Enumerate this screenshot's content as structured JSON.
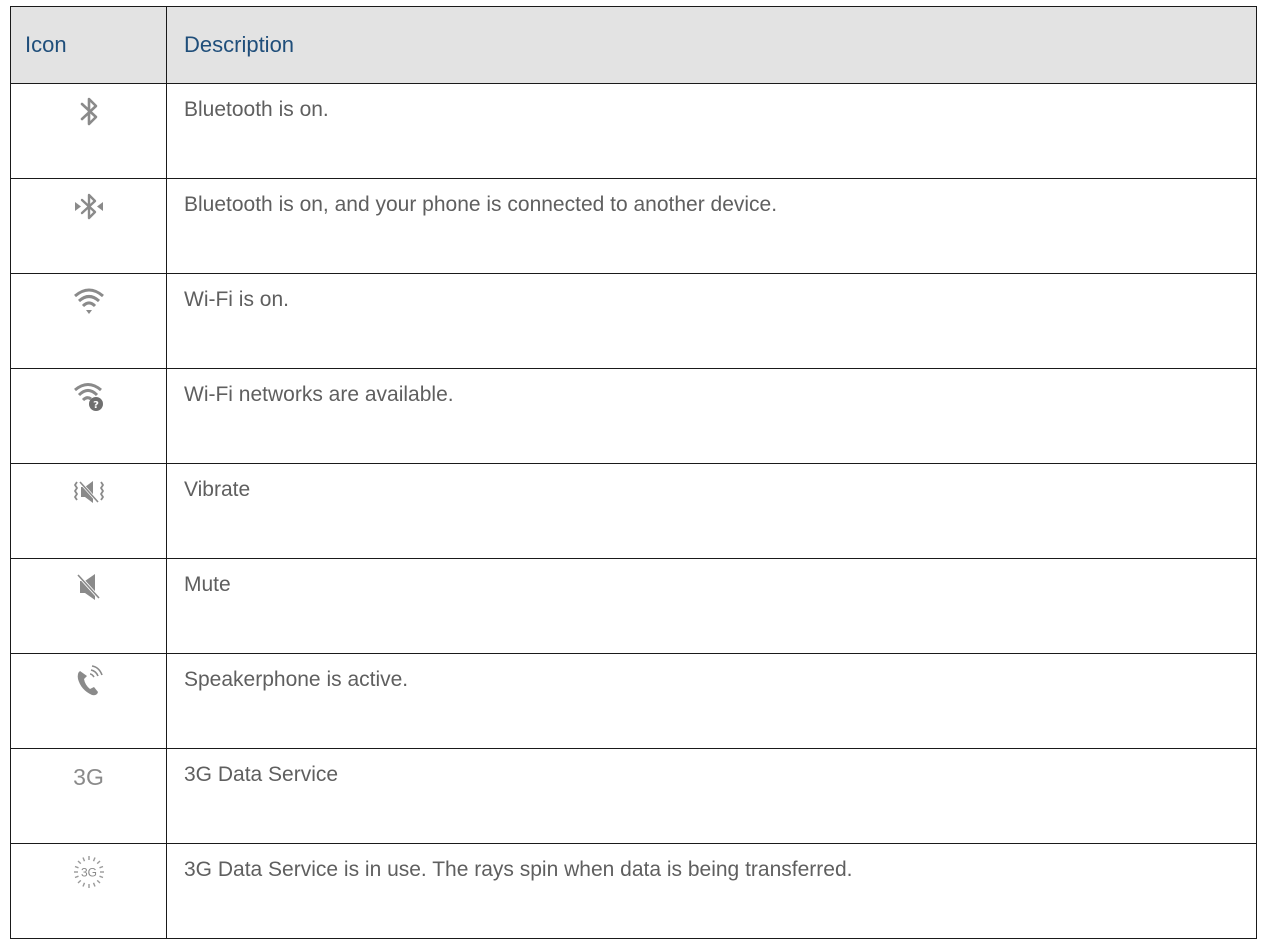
{
  "table": {
    "header": {
      "icon": "Icon",
      "description": "Description"
    },
    "rows": [
      {
        "icon_name": "bluetooth-icon",
        "icon_text": "",
        "description": "Bluetooth is on."
      },
      {
        "icon_name": "bluetooth-connected-icon",
        "icon_text": "",
        "description": "Bluetooth is on, and your phone is connected to another device."
      },
      {
        "icon_name": "wifi-icon",
        "icon_text": "",
        "description": "Wi-Fi is on."
      },
      {
        "icon_name": "wifi-available-icon",
        "icon_text": "",
        "description": "Wi-Fi networks are available."
      },
      {
        "icon_name": "vibrate-icon",
        "icon_text": "",
        "description": "Vibrate"
      },
      {
        "icon_name": "mute-icon",
        "icon_text": "",
        "description": "Mute"
      },
      {
        "icon_name": "speakerphone-icon",
        "icon_text": "",
        "description": "Speakerphone is active."
      },
      {
        "icon_name": "3g-icon",
        "icon_text": "3G",
        "description": "3G Data Service"
      },
      {
        "icon_name": "3g-in-use-icon",
        "icon_text": "3G",
        "description": "3G Data Service is in use. The rays spin when data is being transferred."
      }
    ]
  },
  "colors": {
    "header_background": "#e3e3e3",
    "header_text": "#1f4e7a",
    "body_text": "#5f5f5f",
    "icon_gray": "#8a8a8a",
    "border": "#1a1a1a"
  }
}
